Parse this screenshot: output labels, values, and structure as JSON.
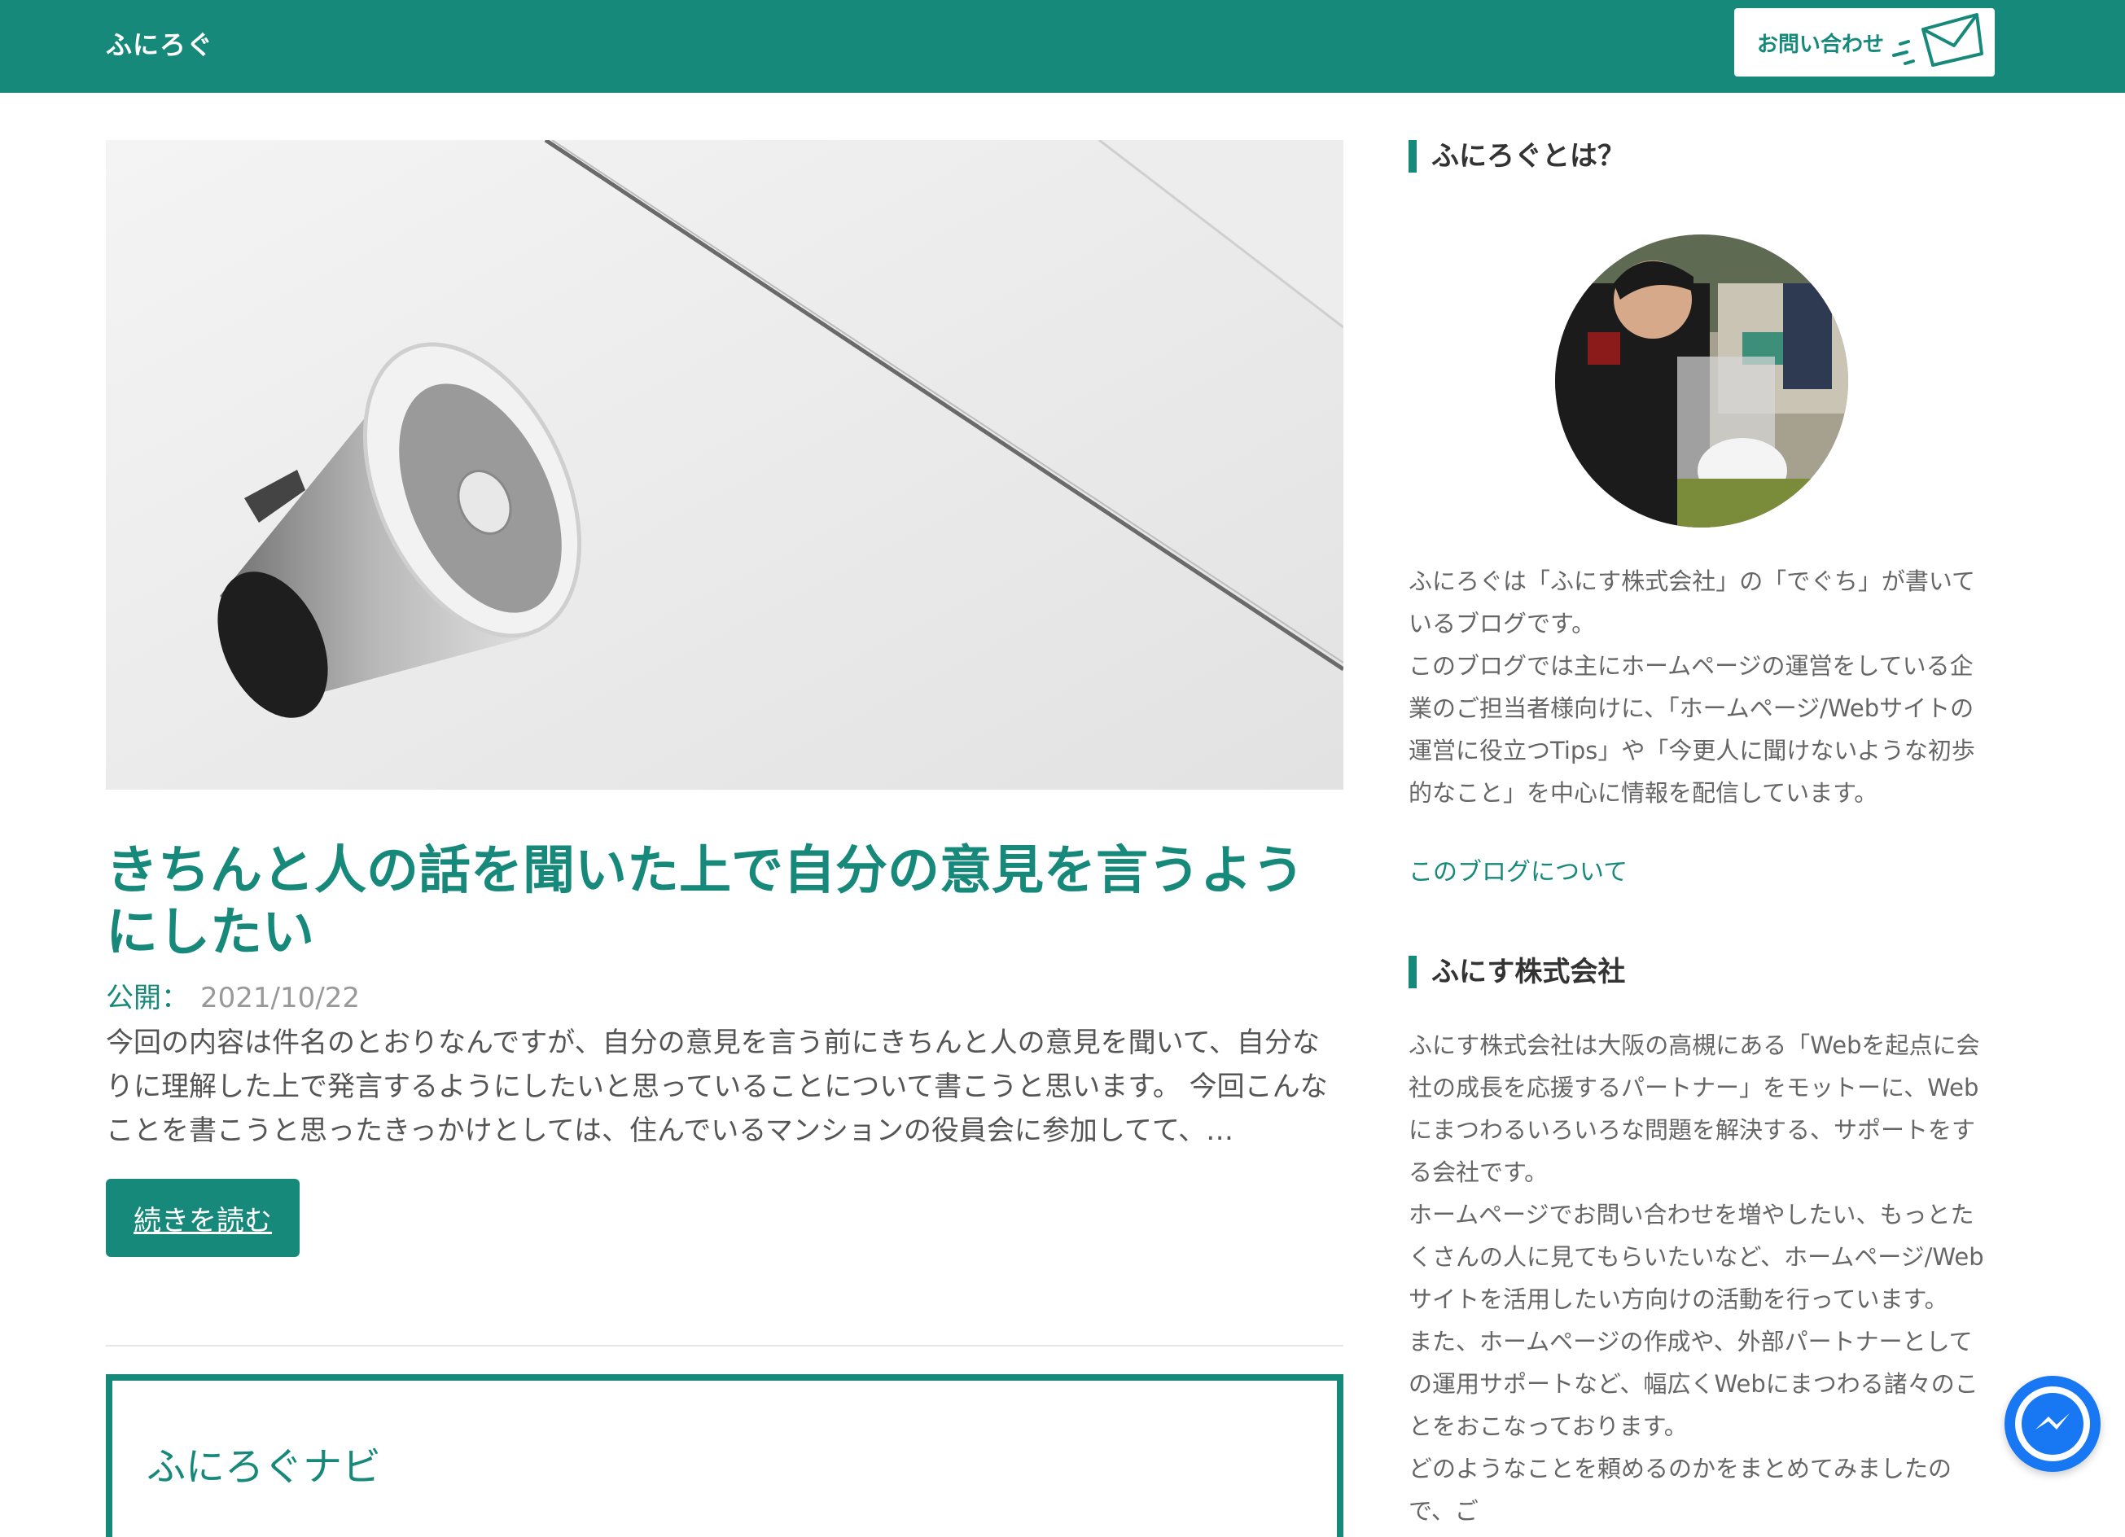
{
  "header": {
    "site_title": "ふにろぐ",
    "contact_label": "お問い合わせ"
  },
  "post": {
    "title": "きちんと人の話を聞いた上で自分の意見を言うようにしたい",
    "published_label": "公開：",
    "published_date": "2021/10/22",
    "excerpt": "今回の内容は件名のとおりなんですが、自分の意見を言う前にきちんと人の意見を聞いて、自分なりに理解した上で発言するようにしたいと思っていることについて書こうと思います。 今回こんなことを書こうと思ったきっかけとしては、住んでいるマンションの役員会に参加してて、…",
    "read_more": "続きを読む"
  },
  "navi": {
    "title": "ふにろぐナビ"
  },
  "sidebar": {
    "about_title": "ふにろぐとは？",
    "about_text": "ふにろぐは「ふにす株式会社」の「でぐち」が書いているブログです。\nこのブログでは主にホームページの運営をしている企業のご担当者様向けに、「ホームページ/Webサイトの運営に役立つTips」や「今更人に聞けないような初歩的なこと」を中心に情報を配信しています。",
    "about_link": "このブログについて",
    "company_title": "ふにす株式会社",
    "company_text": "ふにす株式会社は大阪の高槻にある「Webを起点に会社の成長を応援するパートナー」をモットーに、Webにまつわるいろいろな問題を解決する、サポートをする会社です。\nホームページでお問い合わせを増やしたい、もっとたくさんの人に見てもらいたいなど、ホームページ/Webサイトを活用したい方向けの活動を行っています。\nまた、ホームページの作成や、外部パートナーとしての運用サポートなど、幅広くWebにまつわる諸々のことをおこなっております。\nどのようなことを頼めるのかをまとめてみましたので、ご"
  },
  "icons": {
    "contact": "envelope-icon",
    "chat": "messenger-icon"
  },
  "colors": {
    "brand": "#17897a",
    "messenger": "#1877f2"
  }
}
